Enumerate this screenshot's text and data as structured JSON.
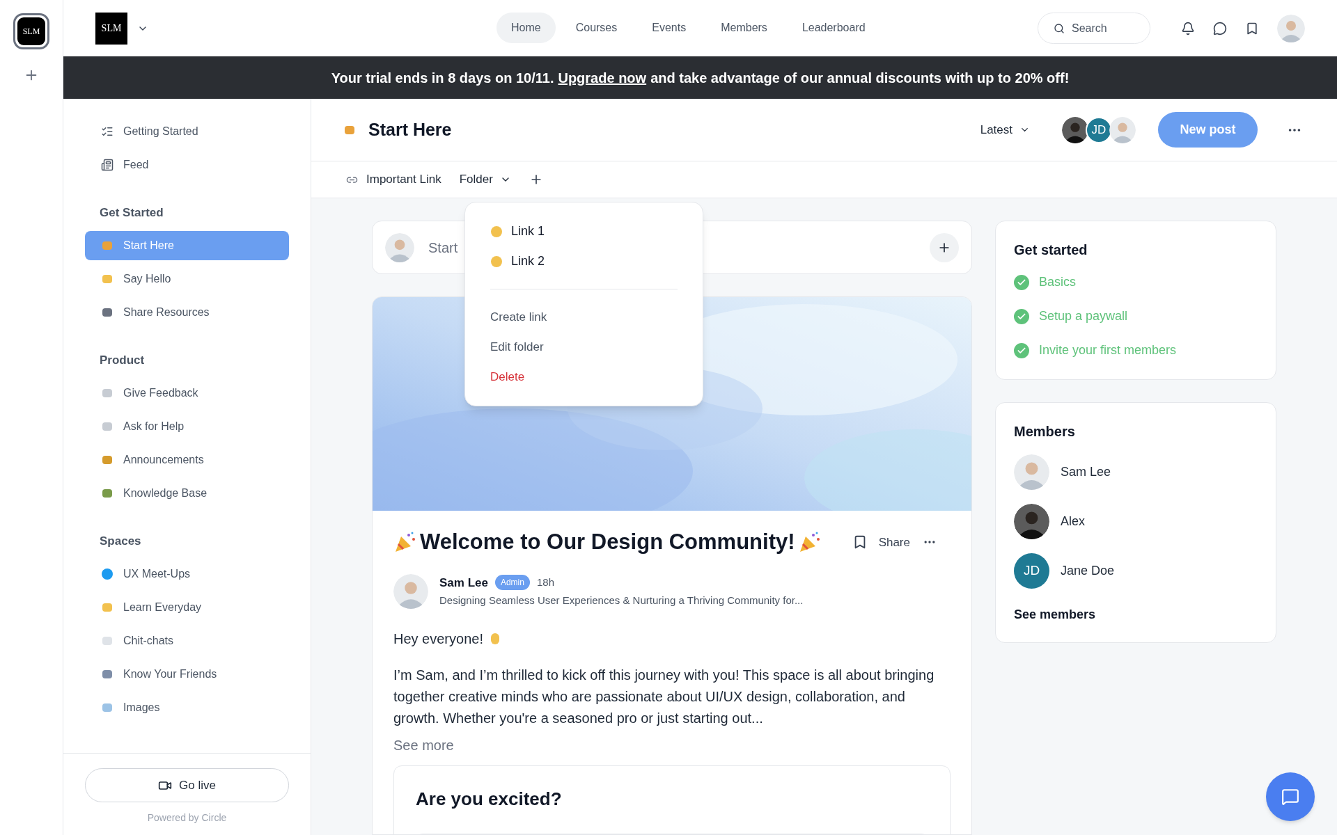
{
  "rail": {
    "logo": "SLM"
  },
  "topbar": {
    "logo": "SLM",
    "nav": [
      {
        "label": "Home",
        "selected": true
      },
      {
        "label": "Courses",
        "selected": false
      },
      {
        "label": "Events",
        "selected": false
      },
      {
        "label": "Members",
        "selected": false
      },
      {
        "label": "Leaderboard",
        "selected": false
      }
    ],
    "search": {
      "placeholder": "Search"
    }
  },
  "banner": {
    "before": "Your trial ends in 8 days on 10/11.",
    "link": "Upgrade now",
    "after": "and take advantage of our annual discounts with up to 20% off!"
  },
  "sidebar": {
    "top_items": [
      {
        "label": "Getting Started",
        "selected": false
      },
      {
        "label": "Feed",
        "selected": false
      }
    ],
    "sections": [
      {
        "title": "Get Started",
        "items": [
          {
            "label": "Start Here",
            "selected": true
          },
          {
            "label": "Say Hello",
            "selected": false
          },
          {
            "label": "Share Resources",
            "selected": false
          }
        ]
      },
      {
        "title": "Product",
        "items": [
          {
            "label": "Give Feedback",
            "selected": false
          },
          {
            "label": "Ask for Help",
            "selected": false
          },
          {
            "label": "Announcements",
            "selected": false
          },
          {
            "label": "Knowledge Base",
            "selected": false
          }
        ]
      },
      {
        "title": "Spaces",
        "items": [
          {
            "label": "UX Meet-Ups",
            "selected": false
          },
          {
            "label": "Learn Everyday",
            "selected": false
          },
          {
            "label": "Chit-chats",
            "selected": false
          },
          {
            "label": "Know Your Friends",
            "selected": false
          },
          {
            "label": "Images",
            "selected": false
          }
        ]
      }
    ],
    "go_live": "Go live",
    "powered_by": "Powered by Circle"
  },
  "space_header": {
    "title": "Start Here",
    "sort": "Latest",
    "avatar_initials": "JD",
    "new_post": "New post"
  },
  "link_bar": {
    "link": "Important Link",
    "folder": "Folder"
  },
  "folder_menu": {
    "links": [
      "Link 1",
      "Link 2"
    ],
    "actions": [
      {
        "label": "Create link",
        "kind": "normal"
      },
      {
        "label": "Edit folder",
        "kind": "normal"
      },
      {
        "label": "Delete",
        "kind": "danger"
      }
    ]
  },
  "composer": {
    "placeholder": "Start"
  },
  "post": {
    "title": "Welcome to Our Design Community!",
    "share": "Share",
    "author": "Sam Lee",
    "badge": "Admin",
    "time": "18h",
    "headline": "Designing Seamless User Experiences & Nurturing a Thriving Community for...",
    "greeting": "Hey everyone!",
    "body": "I’m Sam, and I’m thrilled to kick off this journey with you! This space is all about bringing together creative minds who are passionate about UI/UX design, collaboration, and growth. Whether you're a seasoned pro or just starting out...",
    "see_more": "See more",
    "poll": {
      "question": "Are you excited?"
    }
  },
  "get_started": {
    "title": "Get started",
    "items": [
      {
        "label": "Basics",
        "checked": true
      },
      {
        "label": "Setup a paywall",
        "checked": true
      },
      {
        "label": "Invite your first members",
        "checked": true
      }
    ]
  },
  "members": {
    "title": "Members",
    "items": [
      {
        "name": "Sam Lee"
      },
      {
        "name": "Alex",
        "kind": "photo_dark"
      },
      {
        "name": "Jane Doe",
        "kind": "initials",
        "initials": "JD"
      }
    ],
    "see_all": "See members"
  }
}
